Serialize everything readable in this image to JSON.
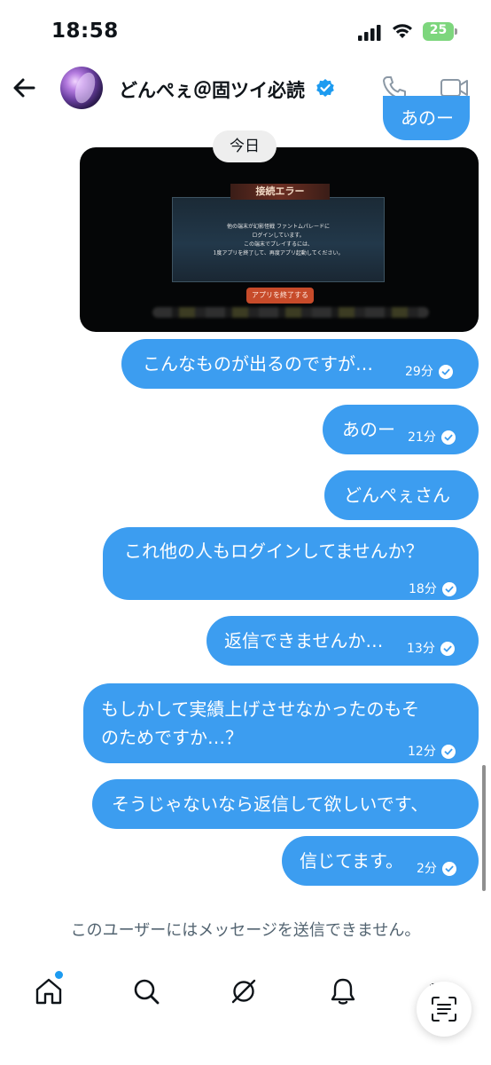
{
  "status_bar": {
    "time": "18:58",
    "battery": "25"
  },
  "header": {
    "contact_name": "どんぺぇ＠固ツイ必読"
  },
  "date_separator": "今日",
  "top_partial_message": "あのー",
  "attachment": {
    "dialog_title": "接続エラー",
    "dialog_lines": [
      "他の端末が幻影怪戦 ファントムパレードに",
      "ログインしています。",
      "この端末でプレイするには、",
      "1度アプリを終了して、再度アプリ起動してください。"
    ],
    "dialog_button": "アプリを終了する"
  },
  "messages": [
    {
      "text": "こんなものが出るのですが…",
      "time": "29分"
    },
    {
      "text": "あのー",
      "time": "21分"
    },
    {
      "text": "どんぺぇさん",
      "time": ""
    },
    {
      "text": "これ他の人もログインしてませんか？",
      "time": "18分"
    },
    {
      "text": "返信できませんか…",
      "time": "13分"
    },
    {
      "text_line1": "もしかして実績上げさせなかったのもそ",
      "text_line2": "のためですか…？",
      "time": "12分"
    },
    {
      "text": "そうじゃないなら返信して欲しいです、",
      "time": ""
    },
    {
      "text": "信じてます。",
      "time": "2分"
    }
  ],
  "blocked_note": "このユーザーにはメッセージを送信できません。",
  "nav": [
    "home-icon",
    "search-icon",
    "grok-icon",
    "bell-icon",
    "mail-icon"
  ],
  "colors": {
    "bubble": "#3c9df0",
    "accent": "#1d9bf0"
  }
}
